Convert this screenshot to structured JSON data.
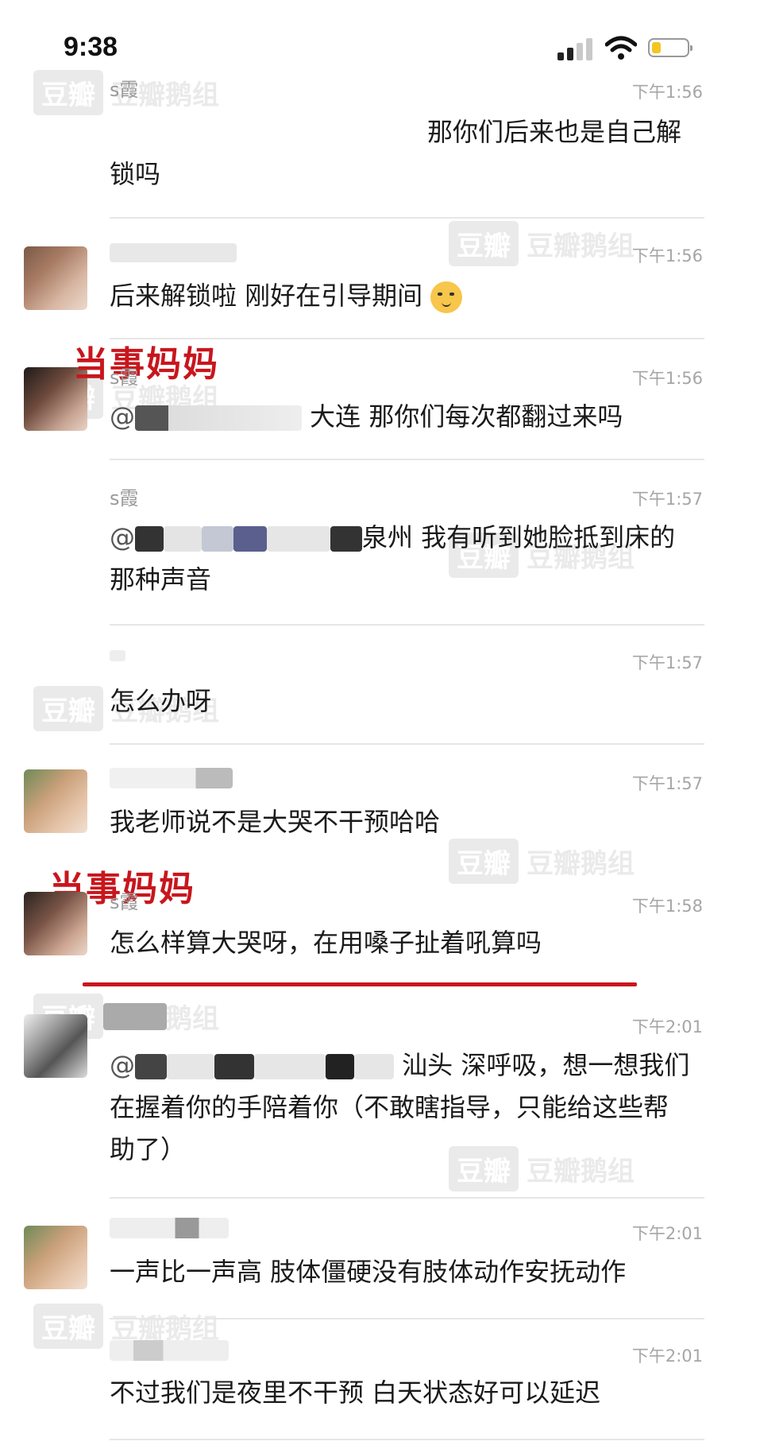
{
  "status_bar": {
    "time": "9:38",
    "battery_level": 0.25
  },
  "watermark": {
    "brand": "豆瓣",
    "group": "豆瓣鹅组"
  },
  "annotation": {
    "mom_label": "当事妈妈"
  },
  "messages": [
    {
      "name": "s霞",
      "time": "下午1:56",
      "text": "那你们后来也是自己解锁吗"
    },
    {
      "name": "",
      "time": "下午1:56",
      "text": "后来解锁啦 刚好在引导期间"
    },
    {
      "name": "s霞",
      "time": "下午1:56",
      "mention": "@",
      "text": "大连 那你们每次都翻过来吗"
    },
    {
      "name": "s霞",
      "time": "下午1:57",
      "mention": "@",
      "text": "泉州 我有听到她脸抵到床的那种声音"
    },
    {
      "name": "",
      "time": "下午1:57",
      "text": "怎么办呀"
    },
    {
      "name": "",
      "time": "下午1:57",
      "text": "我老师说不是大哭不干预哈哈"
    },
    {
      "name": "s霞",
      "time": "下午1:58",
      "text": "怎么样算大哭呀，在用嗓子扯着吼算吗"
    },
    {
      "name": "",
      "time": "下午2:01",
      "mention": "@",
      "text": "汕头 深呼吸，想一想我们在握着你的手陪着你（不敢瞎指导，只能给这些帮助了）"
    },
    {
      "name": "",
      "time": "下午2:01",
      "text": "一声比一声高 肢体僵硬没有肢体动作安抚动作"
    },
    {
      "name": "",
      "time": "下午2:01",
      "text": "不过我们是夜里不干预 白天状态好可以延迟"
    }
  ]
}
